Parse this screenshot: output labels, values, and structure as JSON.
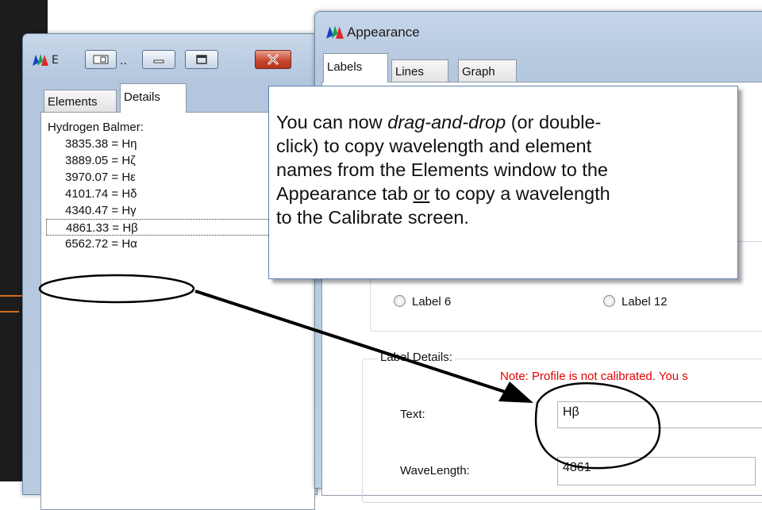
{
  "left_window": {
    "title_fragment": "E",
    "title_ellipsis": "..",
    "tabs": [
      {
        "label": "Elements",
        "active": false
      },
      {
        "label": "Details",
        "active": true
      }
    ],
    "list_heading": "Hydrogen Balmer:",
    "lines": [
      {
        "text": "3835.38 = Hη",
        "selected": false
      },
      {
        "text": "3889.05 = Hζ",
        "selected": false
      },
      {
        "text": "3970.07 = Hε",
        "selected": false
      },
      {
        "text": "4101.74 = Hδ",
        "selected": false
      },
      {
        "text": "4340.47 = Hγ",
        "selected": false
      },
      {
        "text": "4861.33 = Hβ",
        "selected": true
      },
      {
        "text": "6562.72 = Hα",
        "selected": false
      }
    ]
  },
  "appearance_window": {
    "title": "Appearance",
    "tabs": [
      {
        "label": "Labels",
        "active": true
      },
      {
        "label": "Lines",
        "active": false
      },
      {
        "label": "Graph",
        "active": false
      }
    ],
    "radio_label_6": "Label 6",
    "radio_label_12": "Label 12",
    "label_details_legend": "Label Details:",
    "note": "Note: Profile is not calibrated.  You s",
    "text_label": "Text:",
    "text_value": "Hβ",
    "wavelength_label": "WaveLength:",
    "wavelength_value": "4861"
  },
  "callout": {
    "line1_a": "You can now ",
    "line1_b": "drag-and-drop",
    "line1_c": " (or double-",
    "line2": "click) to copy wavelength and element",
    "line3": "names from the Elements window to the",
    "line4": "Appearance tab ",
    "line4_or": "or",
    "line4_c": " to copy a wavelength",
    "line5": "to the Calibrate screen."
  },
  "colors": {
    "note_red": "#e00000",
    "callout_border": "#5b7fb0",
    "window_frame": "#b6c8de"
  },
  "icons": [
    "app-spectrum-icon",
    "minimize-icon",
    "maximize-icon",
    "close-icon",
    "restore-icon"
  ]
}
